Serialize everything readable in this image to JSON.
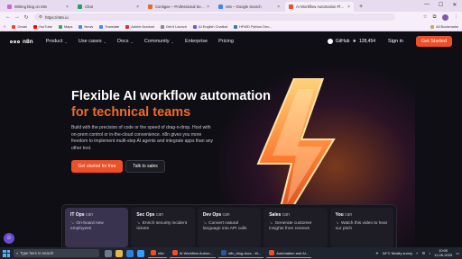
{
  "browser": {
    "tabs": [
      {
        "label": "Writing blog on n8n",
        "color": "#c86cc9",
        "active": false
      },
      {
        "label": "Chat",
        "color": "#1fa462",
        "active": false
      },
      {
        "label": "Contigee – Professional Service",
        "color": "#e46b2e",
        "active": false
      },
      {
        "label": "n8n – Google Search",
        "color": "#4285f4",
        "active": false
      },
      {
        "label": "AI Workflow Automation Platfo",
        "color": "#ee4f27",
        "active": true
      }
    ],
    "url": "https://n8n.io",
    "bookmarks": [
      "Gmail",
      "YouTube",
      "Maps",
      "News",
      "Translate",
      "Adobe Acrobat",
      "Get it Launch",
      "AI English Chatbot",
      "HFWD Python Dev..."
    ],
    "all_bookmarks": "All Bookmarks"
  },
  "nav": {
    "logo": "n8n",
    "links": [
      {
        "label": "Product",
        "dropdown": true
      },
      {
        "label": "Use cases",
        "dropdown": true
      },
      {
        "label": "Docs",
        "dropdown": true
      },
      {
        "label": "Community",
        "dropdown": true
      },
      {
        "label": "Enterprise",
        "dropdown": false
      },
      {
        "label": "Pricing",
        "dropdown": false
      }
    ],
    "github": "GitHub",
    "github_stars": "128,454",
    "signin": "Sign in",
    "get_started": "Get Started"
  },
  "hero": {
    "title_line1": "Flexible AI workflow automation",
    "title_line2": "for technical teams",
    "description": "Build with the precision of code or the speed of drag-n-drop. Host with on-prem control or in-the-cloud convenience. n8n gives you more freedom to implement multi-step AI agents and integrate apps than any other tool.",
    "primary_cta": "Get started for free",
    "secondary_cta": "Talk to sales"
  },
  "cards": [
    {
      "role": "IT Ops",
      "can": "can",
      "text": "On-board new employees",
      "active": true
    },
    {
      "role": "Sec Ops",
      "can": "can",
      "text": "Enrich security incident tickets",
      "active": false
    },
    {
      "role": "Dev Ops",
      "can": "can",
      "text": "Convert natural language into API calls",
      "active": false
    },
    {
      "role": "Sales",
      "can": "can",
      "text": "Generate customer insights from reviews",
      "active": false
    },
    {
      "role": "You",
      "can": "can",
      "text": "Watch this video to hear our pitch",
      "active": false
    }
  ],
  "taskbar": {
    "search_placeholder": "Type here to search",
    "apps": [
      "n8n",
      "AI Workflow Autom...",
      "n8n_blog.docx - W...",
      "Automation and AI..."
    ],
    "weather": "34°C  Mostly sunny",
    "time": "10:00",
    "date": "11-06-2025"
  }
}
